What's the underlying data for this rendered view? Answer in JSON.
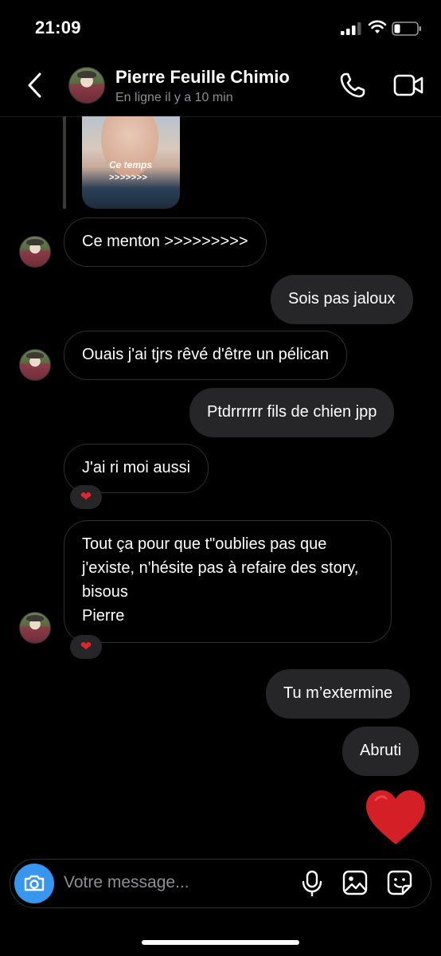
{
  "status_bar": {
    "time": "21:09"
  },
  "header": {
    "name": "Pierre Feuille Chimio",
    "status": "En ligne il y a 10 min"
  },
  "story": {
    "text_line1": "Ce temps",
    "text_line2": ">>>>>>>"
  },
  "messages": [
    {
      "from": "them",
      "text": "Ce menton >>>>>>>>>"
    },
    {
      "from": "me",
      "text": "Sois pas jaloux"
    },
    {
      "from": "them",
      "text": "Ouais j'ai tjrs rêvé d'être un pélican"
    },
    {
      "from": "me",
      "text": "Ptdrrrrrr fils de chien jpp"
    },
    {
      "from": "them",
      "text": "J'ai ri moi aussi",
      "reaction": "❤"
    },
    {
      "from": "them",
      "text": "Tout ça pour que t\"oublies pas que j'existe, n'hésite pas à refaire des story, bisous\nPierre",
      "reaction": "❤"
    },
    {
      "from": "me",
      "text": "Tu m’extermine"
    },
    {
      "from": "me",
      "text": "Abruti"
    }
  ],
  "composer": {
    "placeholder": "Votre message..."
  },
  "colors": {
    "accent": "#3797f0",
    "outgoing_bubble": "#262628",
    "heart": "#e0252d"
  },
  "icons": [
    "back-arrow-icon",
    "phone-icon",
    "video-icon",
    "camera-icon",
    "microphone-icon",
    "gallery-icon",
    "sticker-icon",
    "heart-icon"
  ]
}
